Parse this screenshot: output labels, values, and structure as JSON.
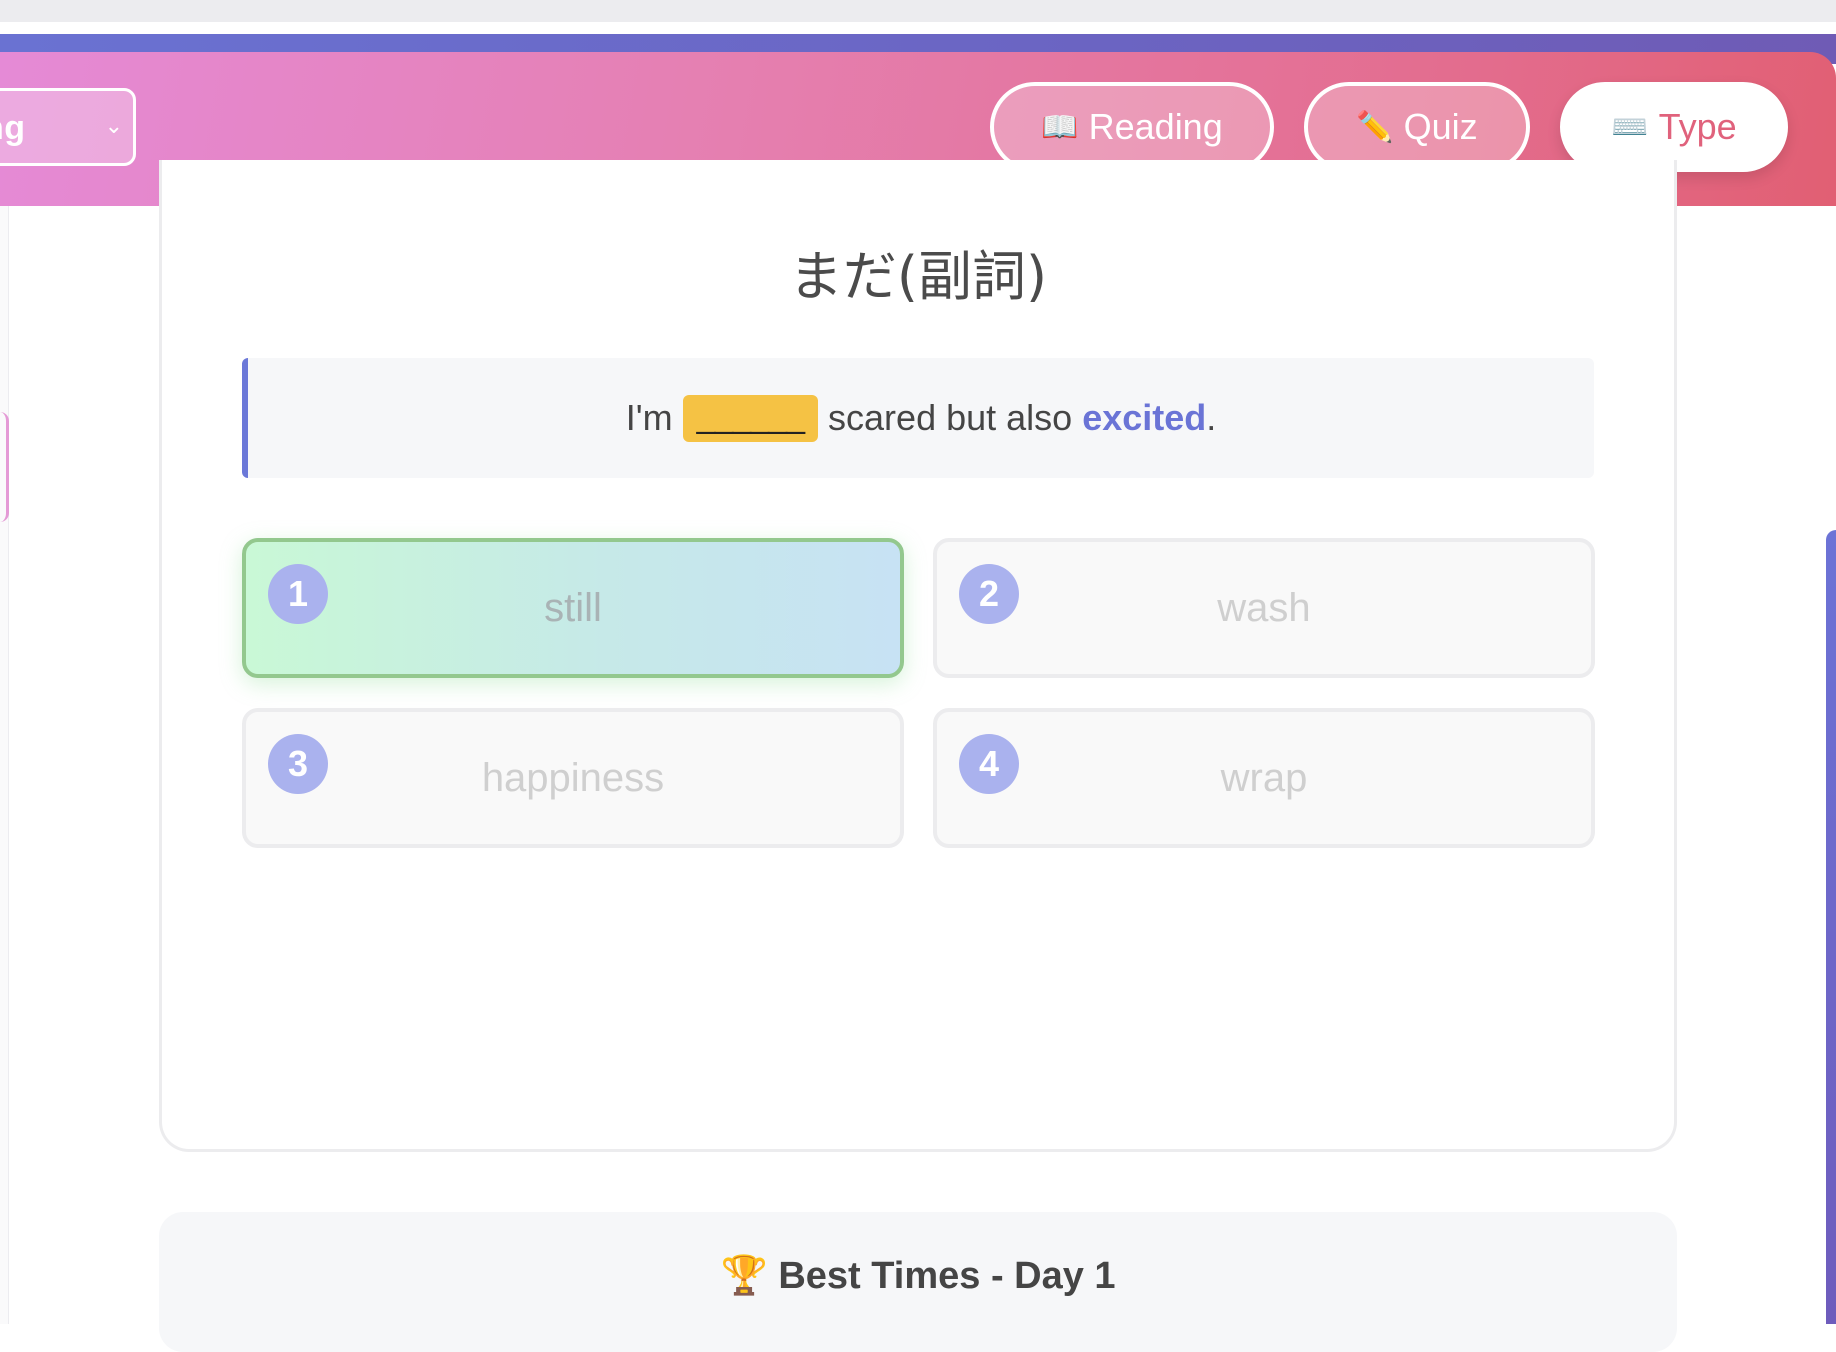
{
  "header": {
    "level_select": {
      "value": "ng"
    },
    "modes": [
      {
        "icon": "open-book-icon",
        "glyph": "📖",
        "label": "Reading",
        "active": false
      },
      {
        "icon": "pencil-icon",
        "glyph": "✏️",
        "label": "Quiz",
        "active": false
      },
      {
        "icon": "keyboard-icon",
        "glyph": "⌨️",
        "label": "Type",
        "active": true
      }
    ]
  },
  "quiz": {
    "word": "まだ(副詞)",
    "sentence": {
      "before": "I'm",
      "blank": "______",
      "middle": "scared but also",
      "highlight": "excited",
      "after": "."
    },
    "options": [
      {
        "number": "1",
        "label": "still",
        "selected": true
      },
      {
        "number": "2",
        "label": "wash",
        "selected": false
      },
      {
        "number": "3",
        "label": "happiness",
        "selected": false
      },
      {
        "number": "4",
        "label": "wrap",
        "selected": false
      }
    ]
  },
  "best_times": {
    "trophy_glyph": "🏆",
    "title": "Best Times - Day 1"
  },
  "colors": {
    "header_gradient_start": "#e58ad6",
    "header_gradient_end": "#e15f73",
    "accent": "#6a74d6",
    "blank_highlight": "#f5c244",
    "selected_border": "#93c88e",
    "option_number_bg": "#aab2ee"
  }
}
